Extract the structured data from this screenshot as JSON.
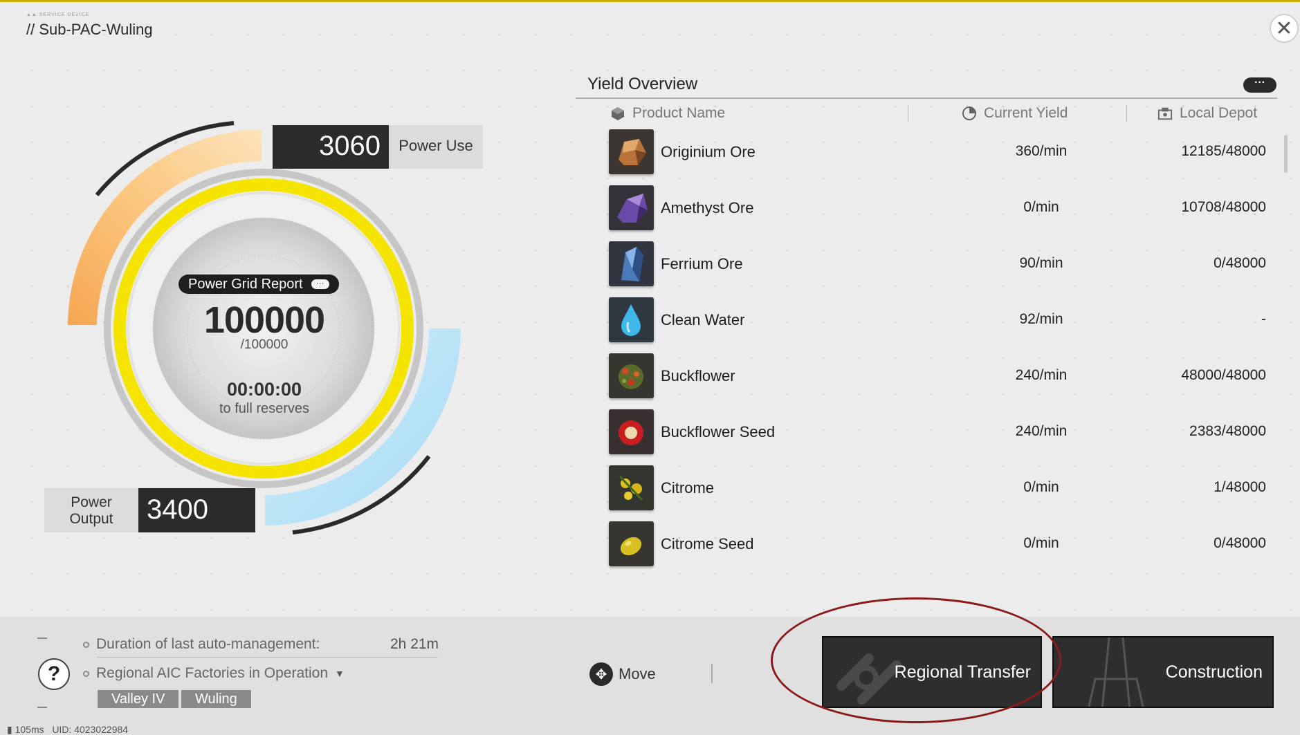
{
  "header": {
    "title": "// Sub-PAC-Wuling",
    "logo_text": "SERVICE DEVICE"
  },
  "power": {
    "use_value": "3060",
    "use_label": "Power Use",
    "output_label_1": "Power",
    "output_label_2": "Output",
    "output_value": "3400",
    "report_label": "Power Grid Report",
    "reserve_value": "100000",
    "reserve_max": "/100000",
    "timer": "00:00:00",
    "timer_label": "to full reserves"
  },
  "yield": {
    "title": "Yield Overview",
    "more": "···",
    "columns": {
      "name": "Product Name",
      "yield": "Current Yield",
      "depot": "Local Depot"
    },
    "rows": [
      {
        "name": "Originium Ore",
        "yield": "360/min",
        "depot": "12185/48000",
        "icon": "originium-ore-icon"
      },
      {
        "name": "Amethyst Ore",
        "yield": "0/min",
        "depot": "10708/48000",
        "icon": "amethyst-ore-icon"
      },
      {
        "name": "Ferrium Ore",
        "yield": "90/min",
        "depot": "0/48000",
        "icon": "ferrium-ore-icon"
      },
      {
        "name": "Clean Water",
        "yield": "92/min",
        "depot": "-",
        "icon": "water-drop-icon"
      },
      {
        "name": "Buckflower",
        "yield": "240/min",
        "depot": "48000/48000",
        "icon": "buckflower-icon"
      },
      {
        "name": "Buckflower Seed",
        "yield": "240/min",
        "depot": "2383/48000",
        "icon": "buckflower-seed-icon"
      },
      {
        "name": "Citrome",
        "yield": "0/min",
        "depot": "1/48000",
        "icon": "citrome-icon"
      },
      {
        "name": "Citrome Seed",
        "yield": "0/min",
        "depot": "0/48000",
        "icon": "citrome-seed-icon"
      }
    ]
  },
  "bottom": {
    "auto_label": "Duration of last auto-management:",
    "auto_value": "2h 21m",
    "factories_label": "Regional AIC Factories in Operation",
    "tags": [
      "Valley IV",
      "Wuling"
    ],
    "help": "?",
    "move_label": "Move",
    "regional_transfer": "Regional Transfer",
    "construction": "Construction"
  },
  "status": {
    "ping": "105ms",
    "uid": "UID: 4023022984"
  },
  "colors": {
    "ring": "#f5e400",
    "power_use": "#f6b14a",
    "power_output": "#a9dcf5",
    "annotation": "#8b1a1a"
  }
}
